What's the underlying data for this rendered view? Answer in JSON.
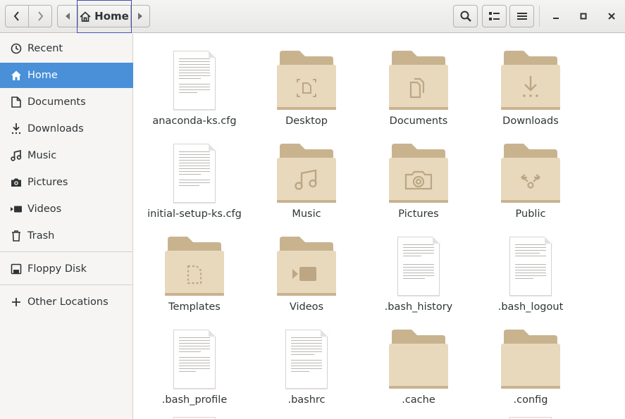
{
  "header": {
    "path_label": "Home"
  },
  "sidebar": {
    "items": [
      {
        "label": "Recent",
        "icon": "clock-icon"
      },
      {
        "label": "Home",
        "icon": "home-icon",
        "active": true
      },
      {
        "label": "Documents",
        "icon": "document-icon"
      },
      {
        "label": "Downloads",
        "icon": "download-icon"
      },
      {
        "label": "Music",
        "icon": "music-icon"
      },
      {
        "label": "Pictures",
        "icon": "camera-icon"
      },
      {
        "label": "Videos",
        "icon": "video-icon"
      },
      {
        "label": "Trash",
        "icon": "trash-icon"
      },
      {
        "label": "Floppy Disk",
        "icon": "floppy-disk-icon"
      },
      {
        "label": "Other Locations",
        "icon": "plus-icon"
      }
    ]
  },
  "files": [
    {
      "name": "anaconda-ks.cfg",
      "kind": "text-file"
    },
    {
      "name": "Desktop",
      "kind": "folder",
      "emblem": "desktop"
    },
    {
      "name": "Documents",
      "kind": "folder",
      "emblem": "documents"
    },
    {
      "name": "Downloads",
      "kind": "folder",
      "emblem": "downloads"
    },
    {
      "name": "initial-setup-ks.cfg",
      "kind": "text-file"
    },
    {
      "name": "Music",
      "kind": "folder",
      "emblem": "music"
    },
    {
      "name": "Pictures",
      "kind": "folder",
      "emblem": "pictures"
    },
    {
      "name": "Public",
      "kind": "folder",
      "emblem": "public"
    },
    {
      "name": "Templates",
      "kind": "folder",
      "emblem": "templates"
    },
    {
      "name": "Videos",
      "kind": "folder",
      "emblem": "videos"
    },
    {
      "name": ".bash_history",
      "kind": "text-file"
    },
    {
      "name": ".bash_logout",
      "kind": "text-file"
    },
    {
      "name": ".bash_profile",
      "kind": "text-file"
    },
    {
      "name": ".bashrc",
      "kind": "text-file"
    },
    {
      "name": ".cache",
      "kind": "folder",
      "emblem": "none"
    },
    {
      "name": ".config",
      "kind": "folder",
      "emblem": "none"
    }
  ],
  "colors": {
    "accent": "#4a90d9",
    "folder_back": "#c9b38f",
    "folder_front": "#e8d9bd",
    "emblem": "#bca684"
  }
}
